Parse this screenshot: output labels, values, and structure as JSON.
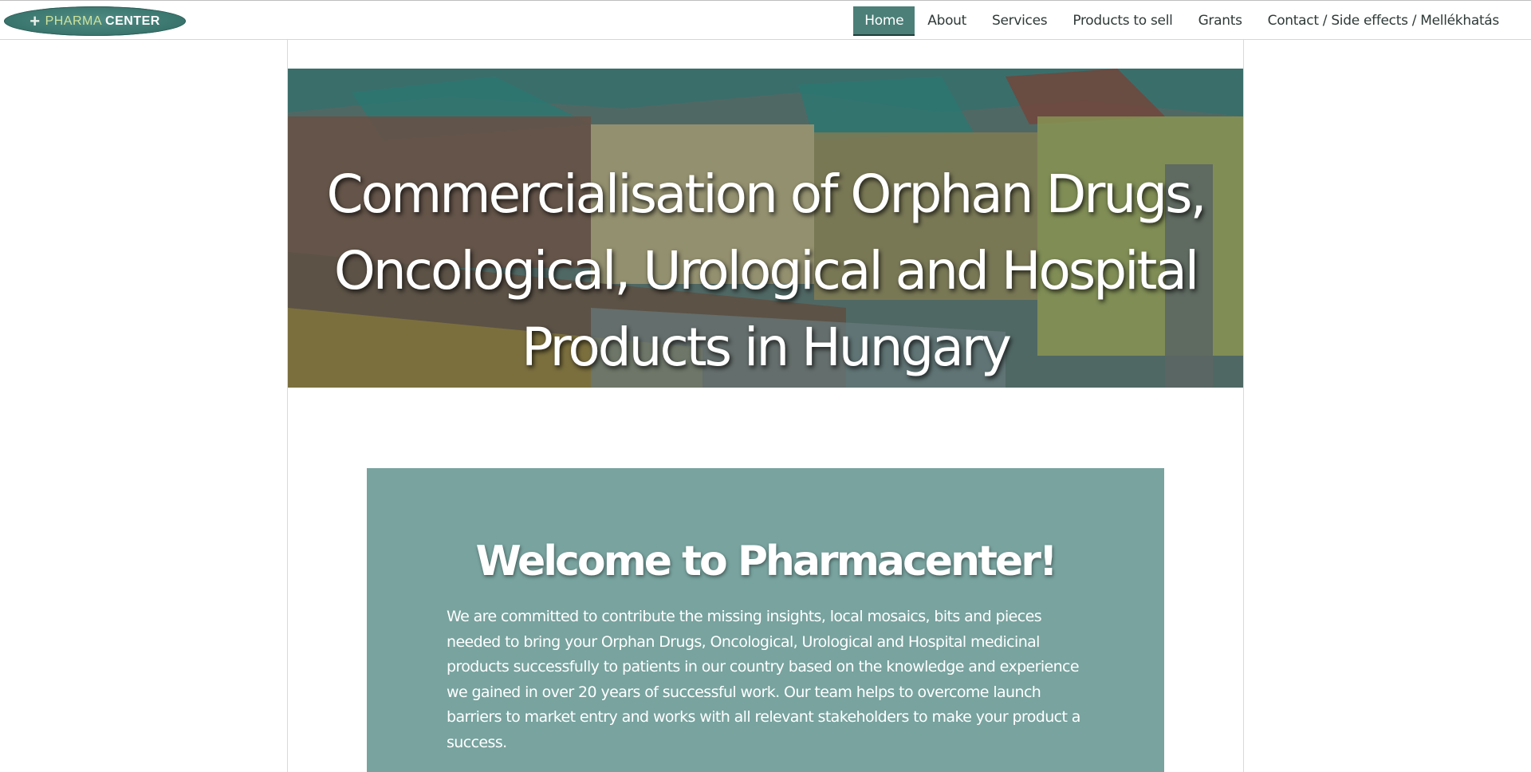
{
  "header": {
    "logo": {
      "icon": "plus-cross-icon",
      "word1": "PHARMA",
      "word2": "CENTER"
    },
    "nav": [
      {
        "label": "Home",
        "active": true
      },
      {
        "label": "About",
        "active": false
      },
      {
        "label": "Services",
        "active": false
      },
      {
        "label": "Products to sell",
        "active": false
      },
      {
        "label": "Grants",
        "active": false
      },
      {
        "label": "Contact / Side effects / Mellékhatás",
        "active": false
      }
    ]
  },
  "hero": {
    "title_lines": [
      "Commercialisation of Orphan Drugs,",
      "Oncological, Urological and Hospital",
      "Products in Hungary"
    ]
  },
  "welcome": {
    "title": "Welcome to Pharmacenter!",
    "body": "We are committed to contribute the missing insights, local mosaics, bits and pieces needed to bring your Orphan Drugs, Oncological, Urological and Hospital medicinal products successfully to patients in our country based on the knowledge and experience we gained in over 20 years of successful work. Our team helps to overcome launch barriers to market entry and works with all relevant stakeholders to make your product a success."
  },
  "colors": {
    "accent": "#4b7f78",
    "welcome_bg": "#78a39f",
    "logo_green": "#cfe39b"
  }
}
